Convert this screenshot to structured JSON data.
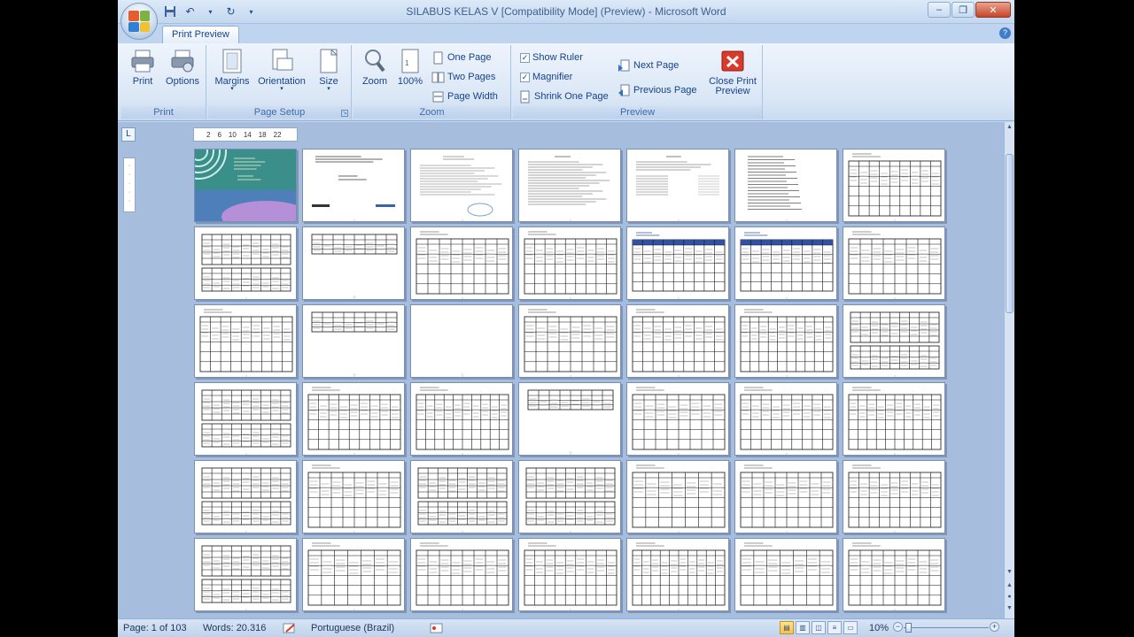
{
  "window": {
    "title": "SILABUS KELAS V [Compatibility Mode] (Preview) - Microsoft Word",
    "controls": [
      "–",
      "❐",
      "✕"
    ]
  },
  "tabs": {
    "active": "Print Preview"
  },
  "ribbon": {
    "print_group": {
      "label": "Print",
      "print_btn": "Print",
      "options_btn": "Options"
    },
    "page_setup_group": {
      "label": "Page Setup",
      "margins_btn": "Margins",
      "orientation_btn": "Orientation",
      "size_btn": "Size"
    },
    "zoom_group": {
      "label": "Zoom",
      "zoom_btn": "Zoom",
      "pct_btn": "100%",
      "one_page": "One Page",
      "two_pages": "Two Pages",
      "page_width": "Page Width"
    },
    "preview_group": {
      "label": "Preview",
      "show_ruler": "Show Ruler",
      "magnifier": "Magnifier",
      "shrink_one_page": "Shrink One Page",
      "next_page": "Next Page",
      "previous_page": "Previous Page",
      "close_line1": "Close Print",
      "close_line2": "Preview",
      "show_ruler_checked": true,
      "magnifier_checked": true
    }
  },
  "ruler": {
    "ruler_toggle": "L",
    "ticks": [
      "2",
      "6",
      "10",
      "14",
      "18",
      "22"
    ]
  },
  "pages": {
    "rows": 6,
    "cols": 7,
    "first_page_type": "cover",
    "page_types": [
      "cover",
      "title",
      "letter",
      "text",
      "list",
      "outline",
      "table",
      "table2",
      "table-top",
      "table",
      "table",
      "table-blue",
      "table-blue",
      "table",
      "table",
      "table-top",
      "blank",
      "table",
      "table",
      "table",
      "table2",
      "table2",
      "table",
      "table",
      "table-top",
      "table",
      "table",
      "table",
      "table2",
      "table",
      "table2",
      "table2",
      "table",
      "table",
      "table",
      "table2",
      "table",
      "table",
      "table",
      "table",
      "table",
      "table"
    ]
  },
  "status": {
    "page": "Page: 1 of 103",
    "words": "Words: 20.316",
    "language": "Portuguese (Brazil)",
    "zoom": "10%",
    "zoom_level_fraction": 0.1
  },
  "colors": {
    "ribbon_text": "#15428b",
    "doc_background": "#a6bddd",
    "cover_teal": "#3a8f8a",
    "table_blue": "#2f52a8"
  }
}
